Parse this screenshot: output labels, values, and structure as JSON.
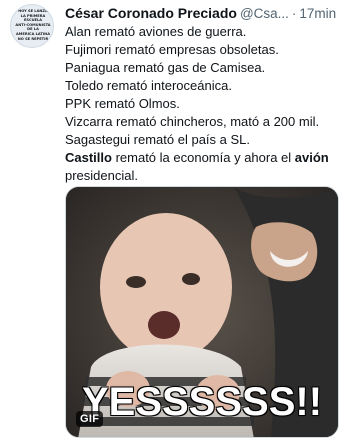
{
  "tweet": {
    "avatar_text": "HOY SE LANZA\nLA PRIMERA\nESCUELA\nANTI-COMUNISTA\nDE LA\nAMERICA LATINA\nNO SE REPETIR",
    "author_name": "César Coronado Preciado",
    "handle": "@Csa...",
    "separator": "·",
    "time": "17min",
    "lines": [
      "Alan remató aviones de guerra.",
      "Fujimori remató empresas obsoletas.",
      "Paniagua remató gas de Camisea.",
      "Toledo remató interoceánica.",
      "PPK remató Olmos.",
      "Vizcarra remató chincheros, mató a 200 mil.",
      "Sagastegui remató el país a SL."
    ],
    "last_line": {
      "bold_1": "Castillo",
      "middle": " remató la economía y ahora el ",
      "bold_2": "avión",
      "end": "presidencial."
    },
    "media": {
      "badge": "GIF",
      "caption": "YESSSSSS!!"
    }
  },
  "colors": {
    "text": "#0f1419",
    "secondary": "#536471",
    "border": "#cfd9de"
  }
}
